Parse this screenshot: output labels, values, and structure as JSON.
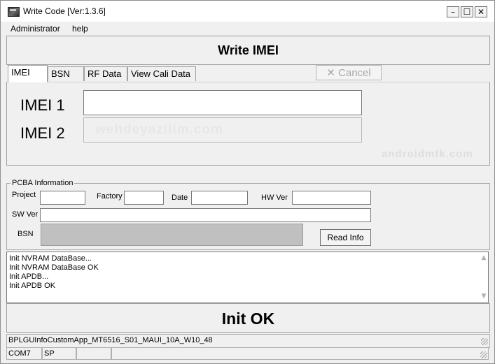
{
  "window": {
    "title": "Write Code [Ver:1.3.6]",
    "controls": {
      "minimize": "–",
      "maximize": "☐",
      "close": "✕"
    }
  },
  "menu": {
    "items": [
      "Administrator",
      "help"
    ]
  },
  "header": {
    "title": "Write IMEI"
  },
  "tabs": [
    "IMEI",
    "BSN",
    "RF Data",
    "View Cali Data"
  ],
  "cancel": {
    "label": "Cancel",
    "icon": "x-cancel-icon"
  },
  "imei": {
    "label1": "IMEI 1",
    "value1": "",
    "label2": "IMEI 2",
    "value2": ""
  },
  "watermarks": [
    "wehdeyazilim.com",
    "androidmtk.com"
  ],
  "pcba": {
    "legend": "PCBA Information",
    "project_label": "Project",
    "project_value": "",
    "factory_label": "Factory",
    "factory_value": "",
    "date_label": "Date",
    "date_value": "",
    "hwver_label": "HW Ver",
    "hwver_value": "",
    "swver_label": "SW Ver",
    "swver_value": "",
    "bsn_label": "BSN",
    "bsn_value": "",
    "read_info": "Read Info"
  },
  "log": {
    "lines": [
      "Init NVRAM DataBase...",
      "Init NVRAM DataBase OK",
      "Init APDB...",
      "Init APDB OK"
    ]
  },
  "status": {
    "text": "Init OK"
  },
  "info": {
    "text": "BPLGUInfoCustomApp_MT6516_S01_MAUI_10A_W10_48"
  },
  "statusbar": {
    "port": "COM7",
    "mode": "SP"
  },
  "colors": {
    "window_bg": "#f0f0f0",
    "bsn_bg": "#c0c0c0",
    "disabled_text": "#a8a8a8"
  }
}
